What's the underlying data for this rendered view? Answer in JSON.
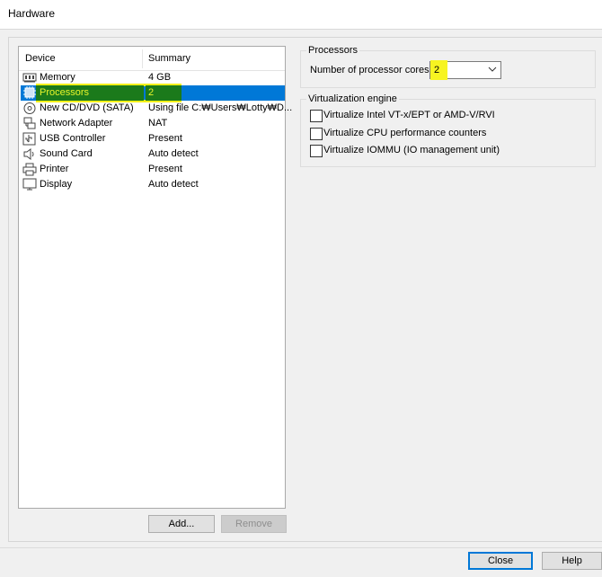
{
  "window": {
    "title": "Hardware"
  },
  "device_list": {
    "columns": {
      "device": "Device",
      "summary": "Summary"
    },
    "rows": [
      {
        "name": "Memory",
        "summary": "4 GB",
        "icon": "memory-icon"
      },
      {
        "name": "Processors",
        "summary": "2",
        "icon": "processor-icon",
        "selected": true
      },
      {
        "name": "New CD/DVD (SATA)",
        "summary": "Using file C:₩Users₩Lotty₩D...",
        "icon": "cd-dvd-icon"
      },
      {
        "name": "Network Adapter",
        "summary": "NAT",
        "icon": "network-adapter-icon"
      },
      {
        "name": "USB Controller",
        "summary": "Present",
        "icon": "usb-icon"
      },
      {
        "name": "Sound Card",
        "summary": "Auto detect",
        "icon": "speaker-icon"
      },
      {
        "name": "Printer",
        "summary": "Present",
        "icon": "printer-icon"
      },
      {
        "name": "Display",
        "summary": "Auto detect",
        "icon": "monitor-icon"
      }
    ],
    "add_label": "Add...",
    "remove_label": "Remove"
  },
  "processors": {
    "group_label": "Processors",
    "cores_label": "Number of processor cores:",
    "cores_value": "2"
  },
  "virtualization": {
    "group_label": "Virtualization engine",
    "options": [
      {
        "label": "Virtualize Intel VT-x/EPT or AMD-V/RVI",
        "checked": false
      },
      {
        "label": "Virtualize CPU performance counters",
        "checked": false
      },
      {
        "label": "Virtualize IOMMU (IO management unit)",
        "checked": false
      }
    ]
  },
  "footer": {
    "close_label": "Close",
    "help_label": "Help"
  },
  "colors": {
    "selection": "#0078d7",
    "annotation_highlight": "#f4f01a",
    "annotation_fill": "#1b7a1b"
  }
}
